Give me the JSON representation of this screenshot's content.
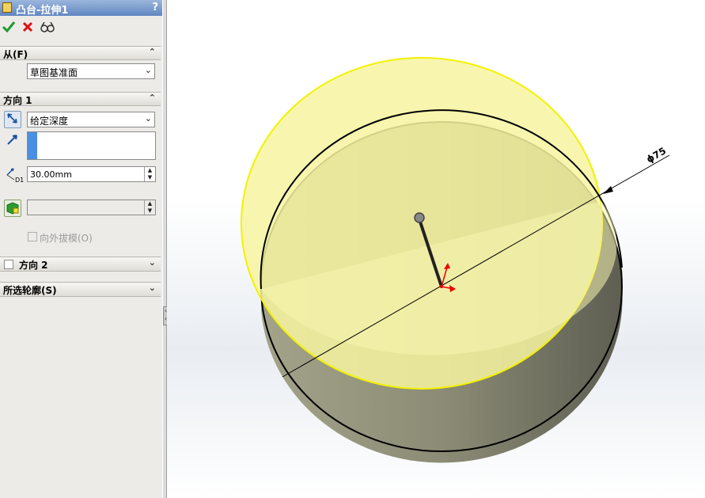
{
  "window": {
    "title": "凸台-拉伸1",
    "help_label": "?"
  },
  "toolbar": {
    "ok_icon": "checkmark-icon",
    "cancel_icon": "x-icon",
    "preview_icon": "glasses-icon"
  },
  "from_section": {
    "title": "从(F)",
    "start_condition": "草图基准面"
  },
  "direction1": {
    "title": "方向 1",
    "end_condition": "给定深度",
    "depth_value": "30.00mm",
    "dimension_tag": "D1",
    "draft_value": "",
    "draft_outward_label": "向外拔模(O)",
    "draft_outward_checked": false
  },
  "direction2": {
    "title": "方向 2",
    "checked": false
  },
  "selected_contours": {
    "title": "所选轮廓(S)"
  },
  "graphics": {
    "diameter_label": "ϕ75"
  },
  "colors": {
    "title_bar": "#5f86c1",
    "preview_fill": "#f7f5a0",
    "preview_edge": "#f2f200",
    "side_shade": "#6e6e60",
    "panel_bg": "#ecebe8"
  }
}
